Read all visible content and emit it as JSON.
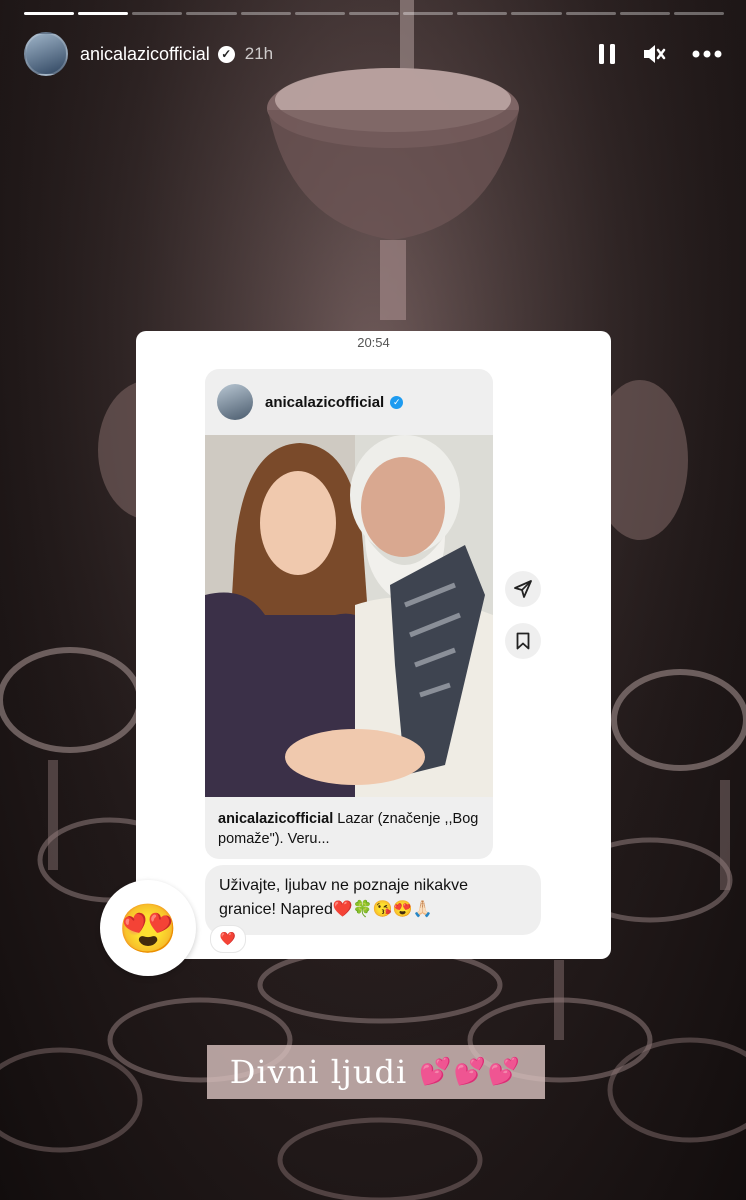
{
  "story": {
    "progress_segments": 13,
    "progress_completed": 2,
    "username": "anicalazicofficial",
    "time_ago": "21h"
  },
  "controls": {
    "pause_icon": "pause-icon",
    "mute_icon": "muted-speaker-icon",
    "more_icon": "more-horizontal-icon"
  },
  "dm_card": {
    "timestamp": "20:54",
    "shared_post": {
      "username": "anicalazicofficial",
      "caption_user": "anicalazicofficial",
      "caption_text": "Lazar (značenje ,,Bog pomaže\"). Veru..."
    },
    "message": "Uživajte, ljubav ne poznaje nikakve granice! Napred❤️🍀😘😍🙏🏻",
    "reaction": "❤️"
  },
  "emoji_sticker": "😍",
  "text_sticker": {
    "text": "Divni ljudi",
    "hearts": "💕💕💕"
  },
  "colors": {
    "background": "#1c1515",
    "sticker_bg": "#d6bebc",
    "verified_badge": "#1d9bf0"
  }
}
